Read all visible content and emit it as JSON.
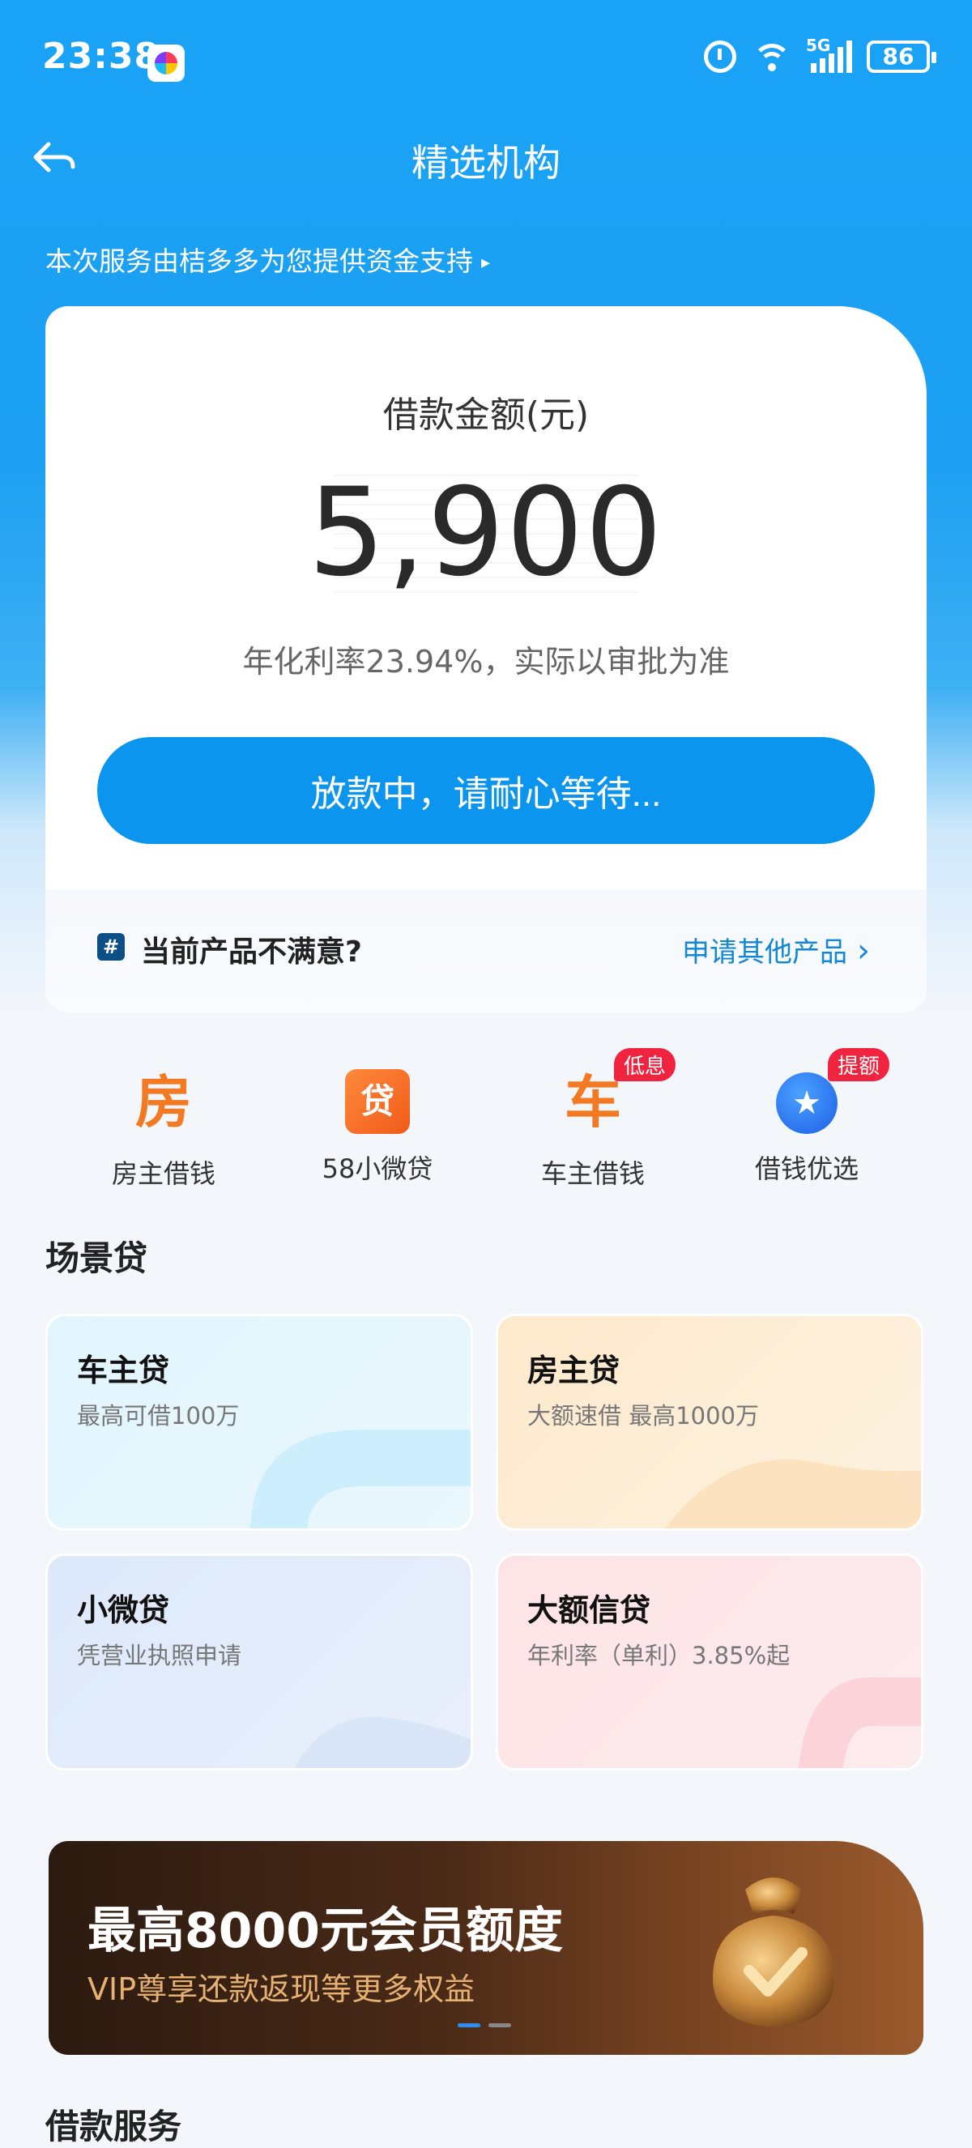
{
  "status_bar": {
    "time": "23:38",
    "network": "5G",
    "battery": "86"
  },
  "header": {
    "title": "精选机构",
    "back_icon": "back-arrow-icon"
  },
  "funding_note": "本次服务由桔多多为您提供资金支持",
  "loan_card": {
    "amount_label": "借款金额(元)",
    "amount": "5,900",
    "rate_note": "年化利率23.94%，实际以审批为准",
    "button_label": "放款中，请耐心等待...",
    "footer_text": "当前产品不满意?",
    "footer_link": "申请其他产品"
  },
  "quick_entries": [
    {
      "label": "房主借钱",
      "icon": "房",
      "badge": ""
    },
    {
      "label": "58小微贷",
      "icon": "贷",
      "badge": ""
    },
    {
      "label": "车主借钱",
      "icon": "车",
      "badge": "低息"
    },
    {
      "label": "借钱优选",
      "icon": "★",
      "badge": "提额"
    }
  ],
  "scene_loans": {
    "title": "场景贷",
    "cards": [
      {
        "title": "车主贷",
        "subtitle": "最高可借100万"
      },
      {
        "title": "房主贷",
        "subtitle": "大额速借 最高1000万"
      },
      {
        "title": "小微贷",
        "subtitle": "凭营业执照申请"
      },
      {
        "title": "大额信贷",
        "subtitle": "年利率（单利）3.85%起"
      }
    ]
  },
  "vip_banner": {
    "title": "最高8000元会员额度",
    "subtitle": "VIP尊享还款返现等更多权益"
  },
  "services_title": "借款服务",
  "colors": {
    "primary": "#0c95ee",
    "header_blue": "#1aa3f7",
    "badge_red": "#f0243f",
    "link_blue": "#1486d6"
  }
}
